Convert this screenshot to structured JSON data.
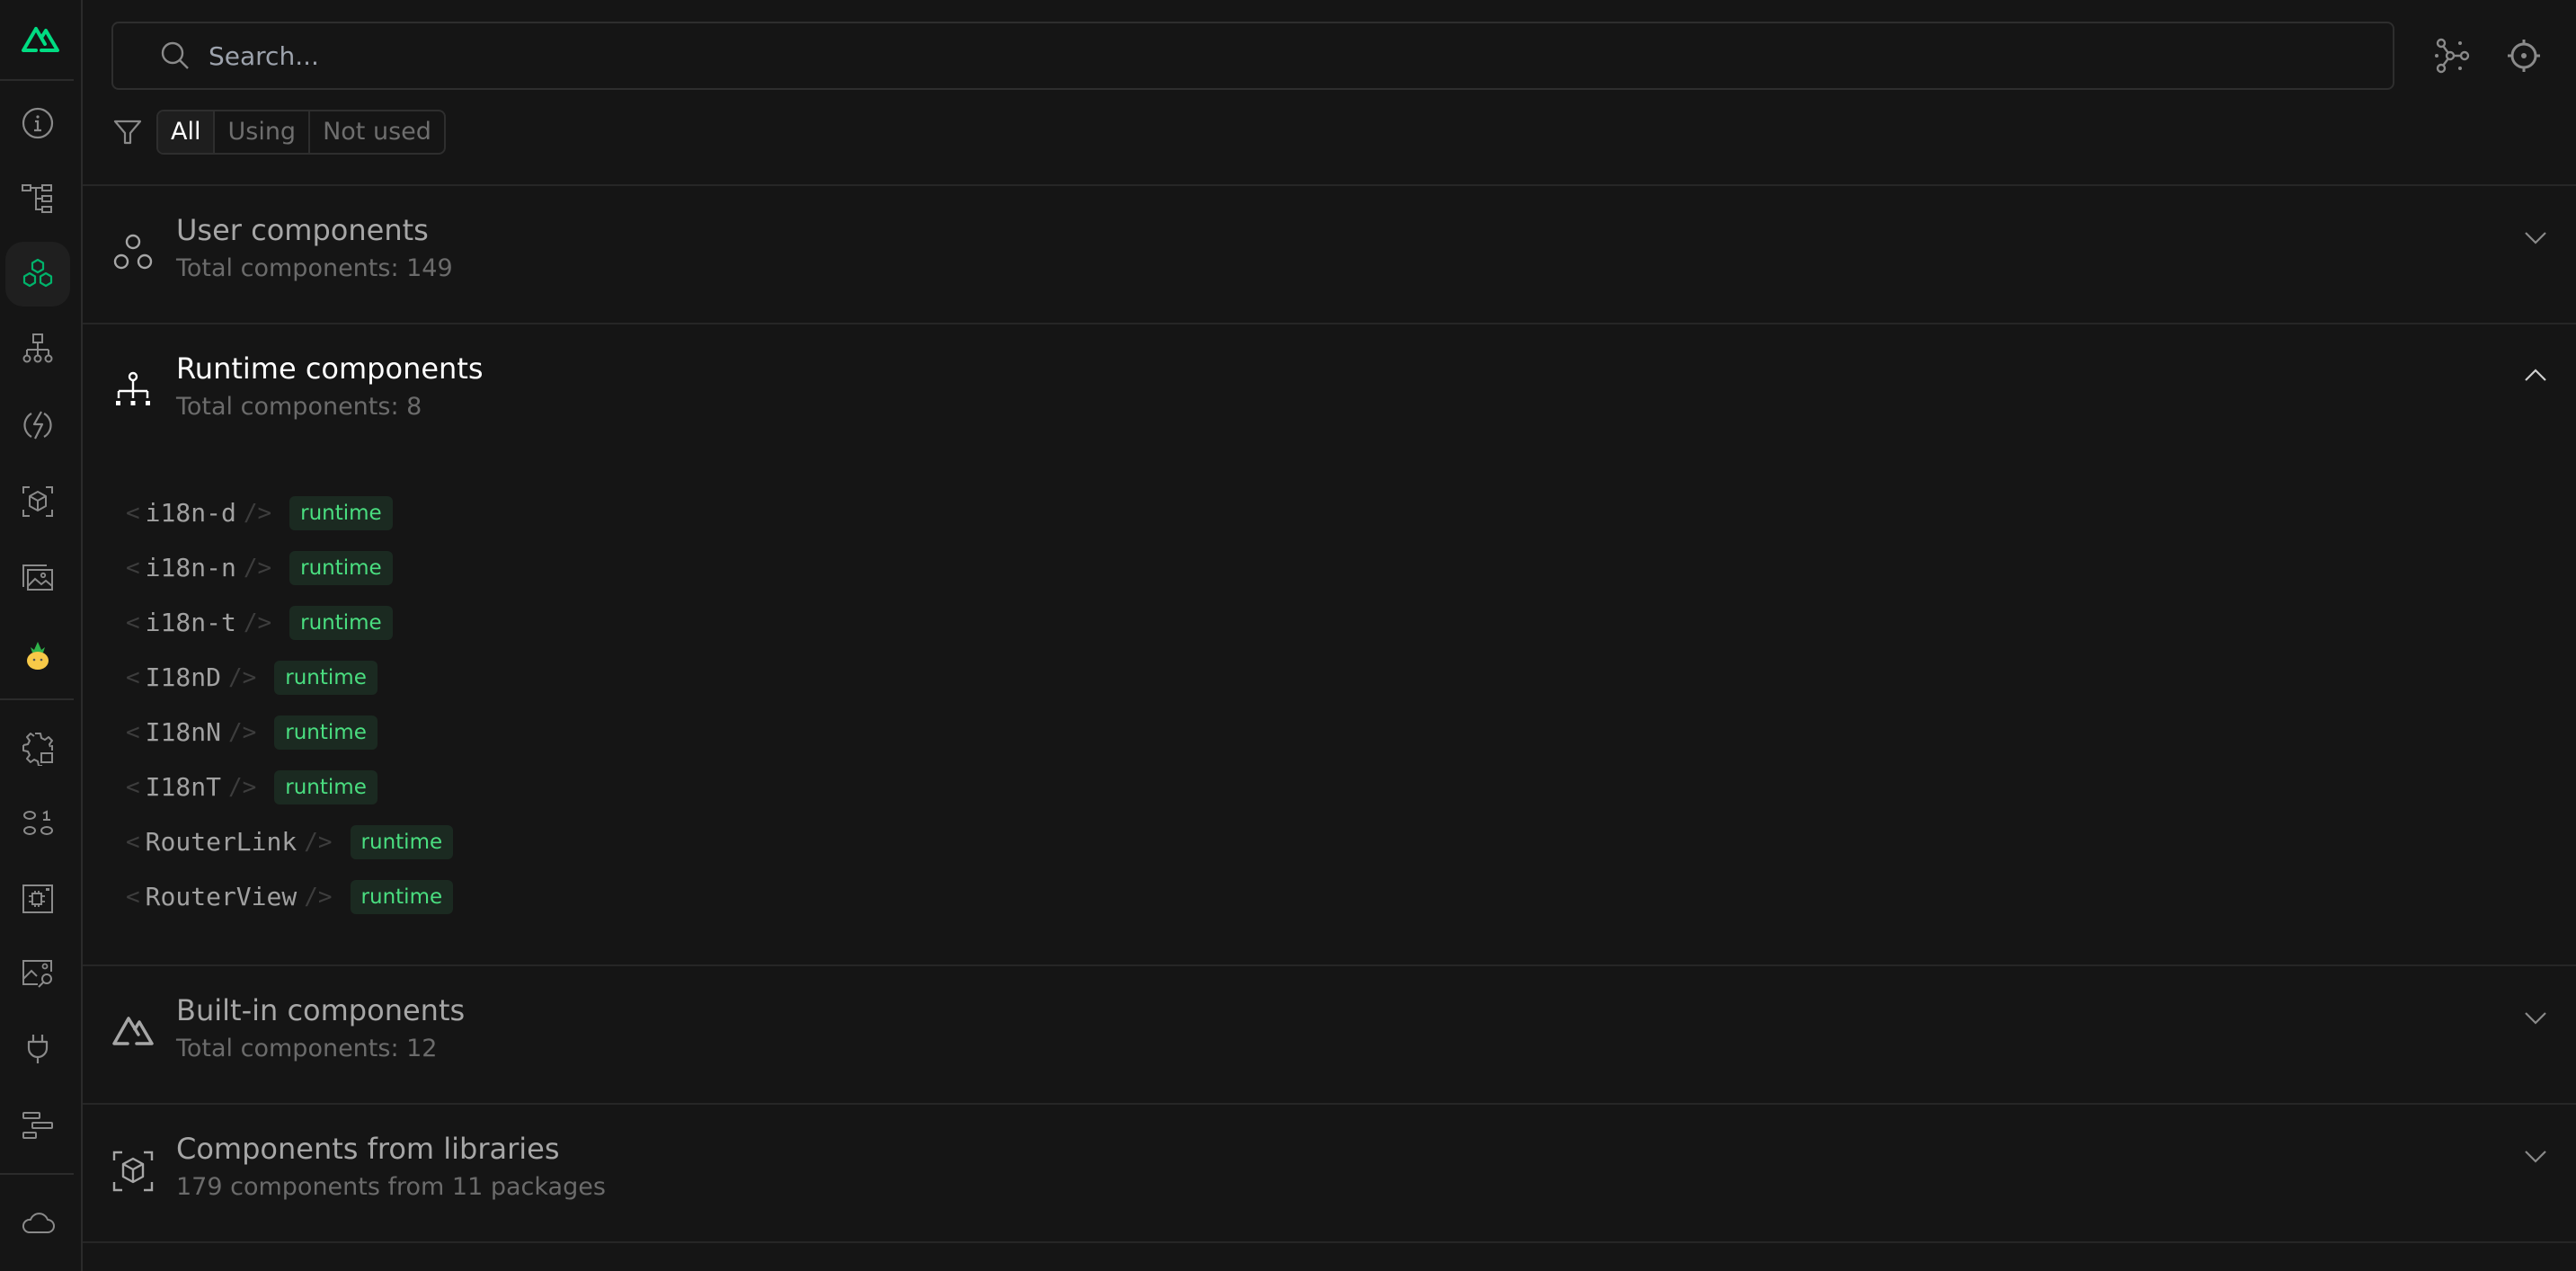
{
  "sidebar": {
    "logo": "nuxt-logo-icon",
    "top_items": [
      {
        "name": "overview",
        "icon": "info-icon"
      },
      {
        "name": "pages",
        "icon": "tree-icon"
      },
      {
        "name": "components",
        "icon": "components-icon",
        "active": true
      },
      {
        "name": "imports",
        "icon": "hierarchy-icon"
      },
      {
        "name": "server-routes",
        "icon": "lightning-icon"
      },
      {
        "name": "modules",
        "icon": "cube-icon"
      },
      {
        "name": "assets",
        "icon": "images-icon"
      },
      {
        "name": "pinia",
        "icon": "pineapple-icon"
      }
    ],
    "bottom_items": [
      {
        "name": "settings",
        "icon": "gear-icon"
      },
      {
        "name": "runtime-config",
        "icon": "binary-icon"
      },
      {
        "name": "render-tree",
        "icon": "chip-icon"
      },
      {
        "name": "inspect",
        "icon": "image-search-icon"
      },
      {
        "name": "hooks",
        "icon": "plug-icon"
      },
      {
        "name": "timeline",
        "icon": "timeline-icon"
      }
    ],
    "footer_item": {
      "name": "cloud",
      "icon": "cloud-icon"
    }
  },
  "search": {
    "placeholder": "Search...",
    "value": ""
  },
  "toolbar": {
    "graph_icon": "graph-icon",
    "inspect_icon": "target-icon"
  },
  "filter": {
    "options": [
      "All",
      "Using",
      "Not used"
    ],
    "selected": "All"
  },
  "sections": [
    {
      "title": "User components",
      "subtitle": "Total components: 149",
      "expanded": false
    },
    {
      "title": "Runtime components",
      "subtitle": "Total components: 8",
      "expanded": true
    },
    {
      "title": "Built-in components",
      "subtitle": "Total components: 12",
      "expanded": false
    },
    {
      "title": "Components from libraries",
      "subtitle": "179 components from 11 packages",
      "expanded": false
    }
  ],
  "runtime_components": [
    {
      "name": "i18n-d",
      "badge": "runtime"
    },
    {
      "name": "i18n-n",
      "badge": "runtime"
    },
    {
      "name": "i18n-t",
      "badge": "runtime"
    },
    {
      "name": "I18nD",
      "badge": "runtime"
    },
    {
      "name": "I18nN",
      "badge": "runtime"
    },
    {
      "name": "I18nT",
      "badge": "runtime"
    },
    {
      "name": "RouterLink",
      "badge": "runtime"
    },
    {
      "name": "RouterView",
      "badge": "runtime"
    }
  ],
  "tag": {
    "open": "<",
    "close": "/>"
  },
  "colors": {
    "accent": "#00dc82",
    "badge_text": "#4ade80",
    "badge_bg": "#1b2a21",
    "background": "#151515"
  }
}
